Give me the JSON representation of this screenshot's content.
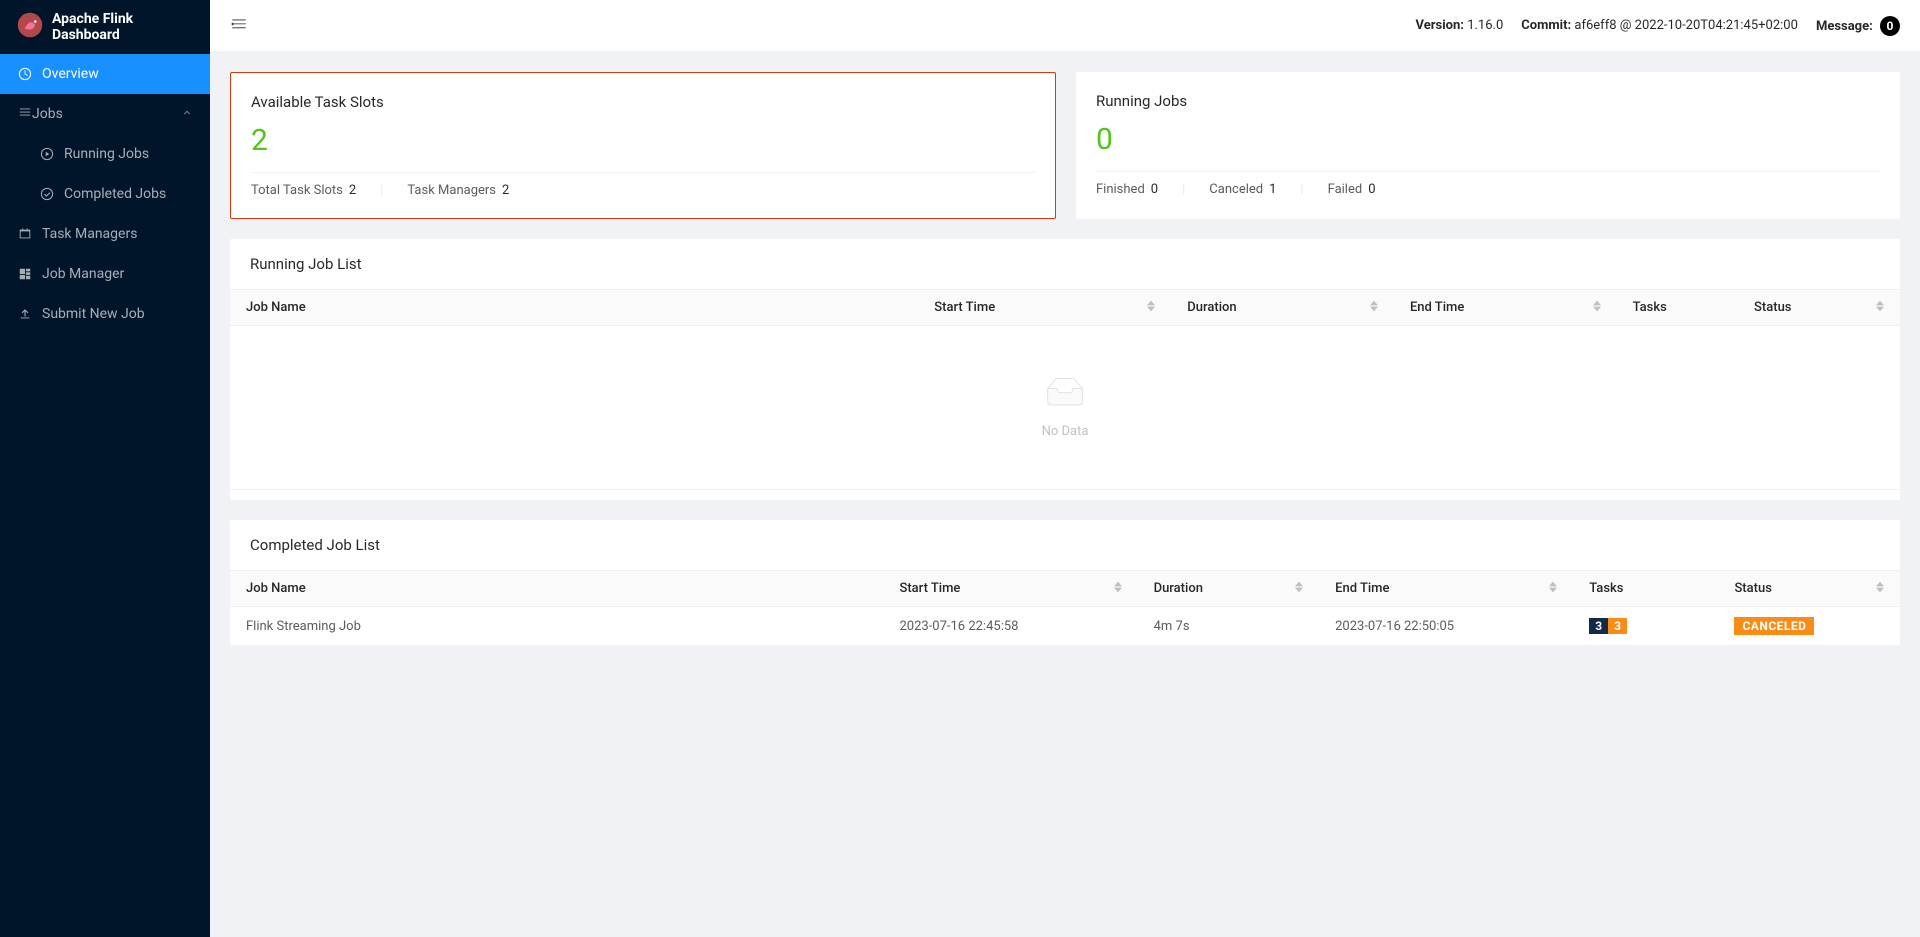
{
  "app": {
    "title": "Apache Flink Dashboard"
  },
  "sidebar": {
    "overview": "Overview",
    "jobs": "Jobs",
    "running_jobs": "Running Jobs",
    "completed_jobs": "Completed Jobs",
    "task_managers": "Task Managers",
    "job_manager": "Job Manager",
    "submit_new_job": "Submit New Job"
  },
  "topbar": {
    "version_label": "Version:",
    "version_value": "1.16.0",
    "commit_label": "Commit:",
    "commit_value": "af6eff8 @ 2022-10-20T04:21:45+02:00",
    "message_label": "Message:",
    "message_count": "0"
  },
  "slots_card": {
    "title": "Available Task Slots",
    "value": "2",
    "total_label": "Total Task Slots",
    "total_value": "2",
    "tm_label": "Task Managers",
    "tm_value": "2"
  },
  "jobs_card": {
    "title": "Running Jobs",
    "value": "0",
    "finished_label": "Finished",
    "finished_value": "0",
    "canceled_label": "Canceled",
    "canceled_value": "1",
    "failed_label": "Failed",
    "failed_value": "0"
  },
  "running_list": {
    "title": "Running Job List",
    "headers": {
      "job_name": "Job Name",
      "start_time": "Start Time",
      "duration": "Duration",
      "end_time": "End Time",
      "tasks": "Tasks",
      "status": "Status"
    },
    "empty": "No Data"
  },
  "completed_list": {
    "title": "Completed Job List",
    "headers": {
      "job_name": "Job Name",
      "start_time": "Start Time",
      "duration": "Duration",
      "end_time": "End Time",
      "tasks": "Tasks",
      "status": "Status"
    },
    "rows": [
      {
        "job_name": "Flink Streaming Job",
        "start_time": "2023-07-16 22:45:58",
        "duration": "4m 7s",
        "end_time": "2023-07-16 22:50:05",
        "task_a": "3",
        "task_b": "3",
        "status": "CANCELED"
      }
    ]
  }
}
